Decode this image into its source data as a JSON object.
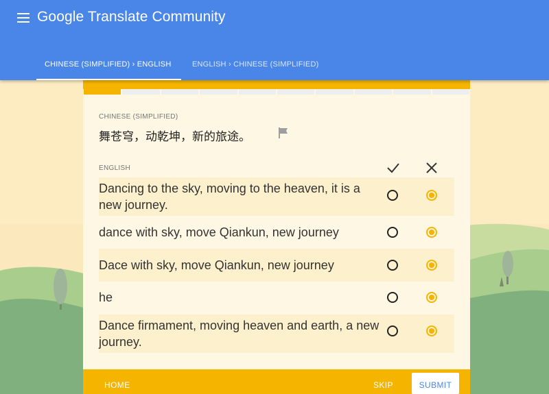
{
  "app": {
    "title": "Google Translate Community",
    "menu_icon": "hamburger-menu-icon"
  },
  "tabs": [
    {
      "label": "CHINESE (SIMPLIFIED) › ENGLISH",
      "active": true
    },
    {
      "label": "ENGLISH › CHINESE (SIMPLIFIED)",
      "active": false
    }
  ],
  "progress": {
    "completed_steps": 1,
    "total_steps": 10
  },
  "source": {
    "language_label": "CHINESE (SIMPLIFIED)",
    "text": "舞苍穹，动乾坤，新的旅途。",
    "flag_icon": "flag-icon"
  },
  "target": {
    "language_label": "ENGLISH",
    "approve_icon": "check-icon",
    "reject_icon": "close-icon"
  },
  "translations": [
    {
      "text": "Dancing to the sky, moving to the heaven, it is a new journey.",
      "selected": "reject"
    },
    {
      "text": "dance with sky, move Qiankun, new journey",
      "selected": "reject"
    },
    {
      "text": "Dace with sky, move Qiankun, new journey",
      "selected": "reject"
    },
    {
      "text": "he",
      "selected": "reject"
    },
    {
      "text": "Dance firmament, moving heaven and earth, a new journey.",
      "selected": "reject"
    }
  ],
  "footer": {
    "home_label": "HOME",
    "skip_label": "SKIP",
    "submit_label": "SUBMIT"
  },
  "colors": {
    "app_bar": "#4a86e8",
    "accent": "#f4b400",
    "card": "#fef7e4"
  }
}
